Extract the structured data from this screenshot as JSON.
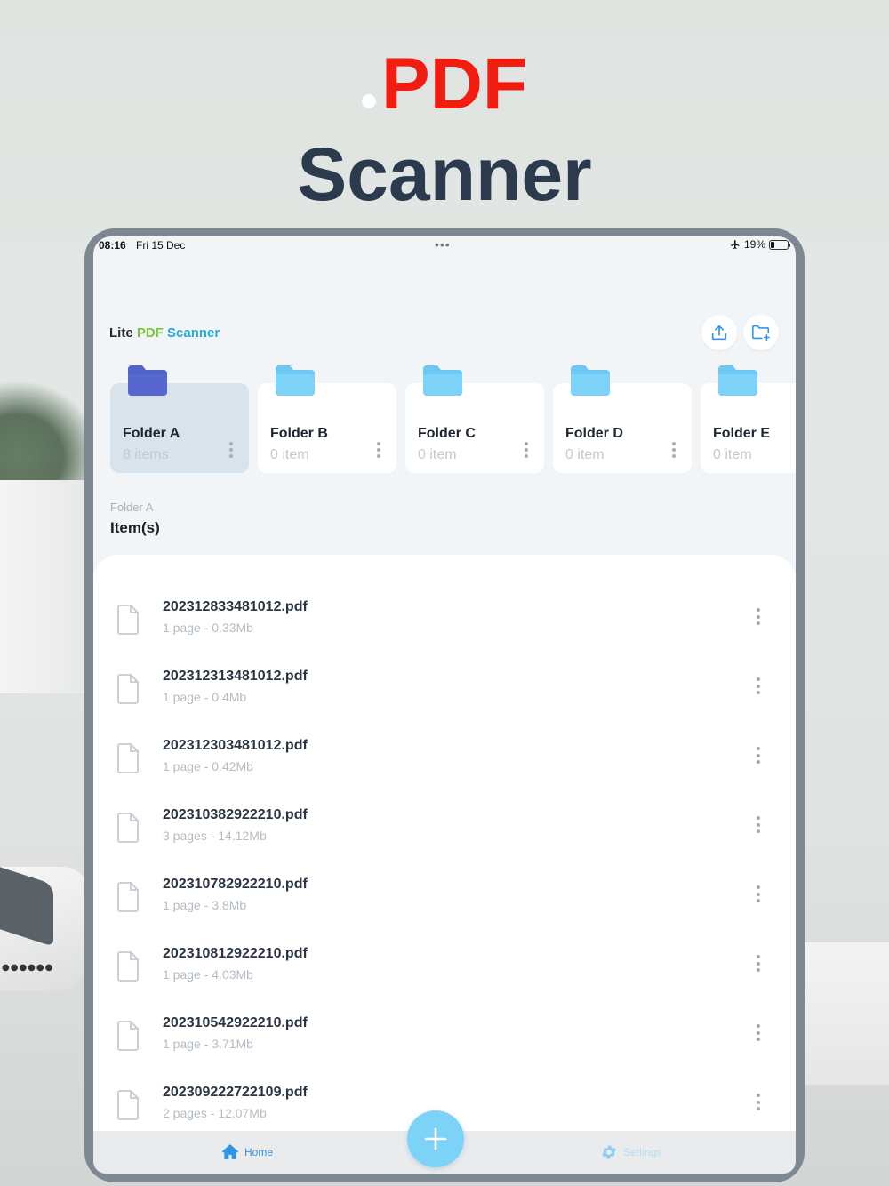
{
  "hero": {
    "line1": "PDF",
    "line2": "Scanner"
  },
  "status_bar": {
    "time": "08:16",
    "date": "Fri 15 Dec",
    "battery": "19%",
    "icons": [
      "airplane-icon",
      "battery-icon"
    ]
  },
  "header": {
    "title_lite": "Lite",
    "title_pdf": "PDF",
    "title_scanner": "Scanner",
    "buttons": [
      "upload-icon",
      "new-folder-icon"
    ]
  },
  "folders": [
    {
      "name": "Folder A",
      "count": "8 items",
      "selected": true
    },
    {
      "name": "Folder B",
      "count": "0 item",
      "selected": false
    },
    {
      "name": "Folder C",
      "count": "0 item",
      "selected": false
    },
    {
      "name": "Folder D",
      "count": "0 item",
      "selected": false
    },
    {
      "name": "Folder E",
      "count": "0 item",
      "selected": false
    }
  ],
  "breadcrumb": "Folder A",
  "section_title": "Item(s)",
  "files": [
    {
      "name": "202312833481012.pdf",
      "meta": "1 page - 0.33Mb"
    },
    {
      "name": "202312313481012.pdf",
      "meta": "1 page - 0.4Mb"
    },
    {
      "name": "202312303481012.pdf",
      "meta": "1 page - 0.42Mb"
    },
    {
      "name": "202310382922210.pdf",
      "meta": "3 pages - 14.12Mb"
    },
    {
      "name": "202310782922210.pdf",
      "meta": "1 page - 3.8Mb"
    },
    {
      "name": "202310812922210.pdf",
      "meta": "1 page - 4.03Mb"
    },
    {
      "name": "202310542922210.pdf",
      "meta": "1 page - 3.71Mb"
    },
    {
      "name": "202309222722109.pdf",
      "meta": "2 pages - 12.07Mb"
    }
  ],
  "tabbar": {
    "home": "Home",
    "settings": "Settings"
  },
  "colors": {
    "hero_red": "#f21d10",
    "hero_navy": "#2b3a4c",
    "accent_blue": "#2f93e6",
    "folder_selected": "#4f63c9",
    "folder_default": "#7dd3f7",
    "fab": "#7dd3f7"
  }
}
